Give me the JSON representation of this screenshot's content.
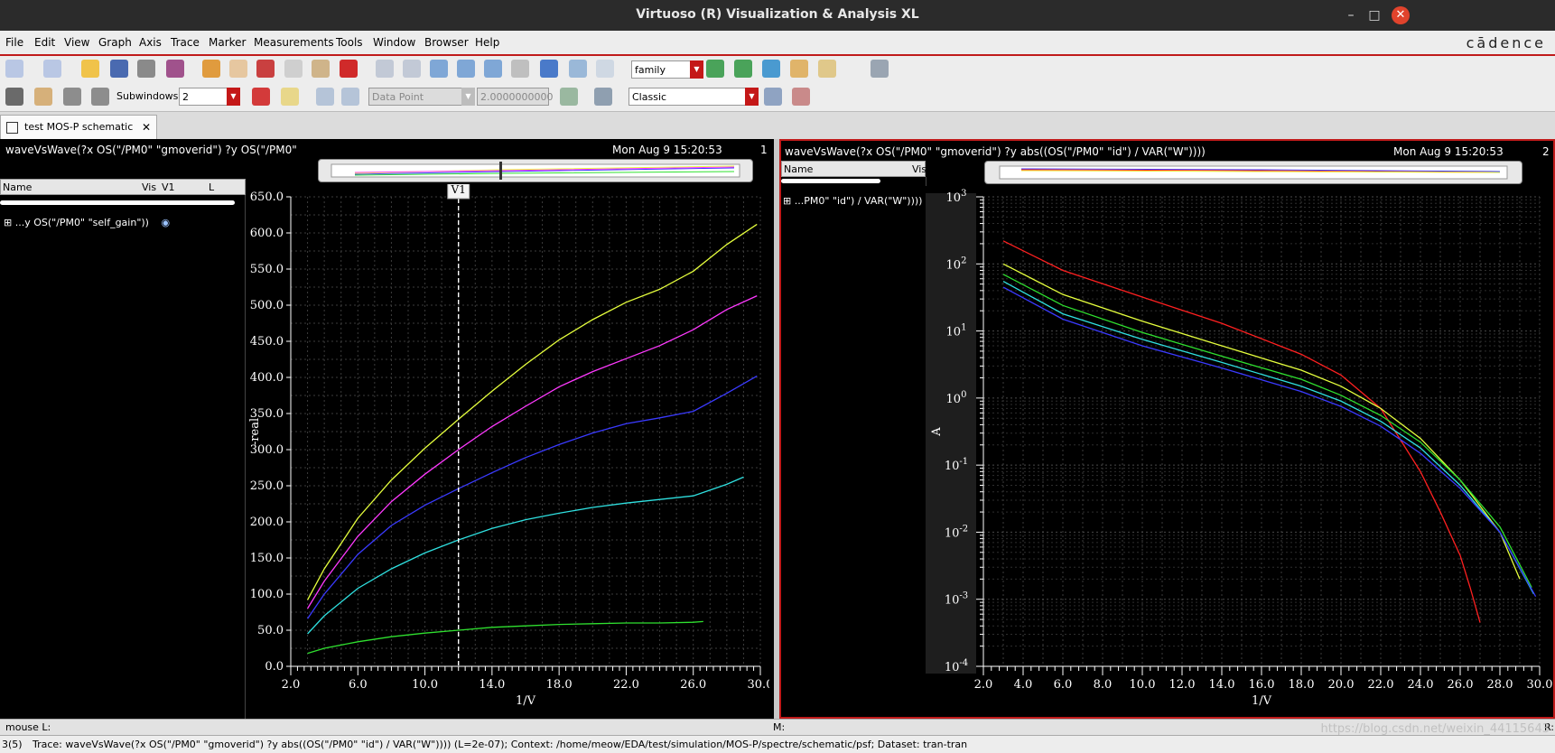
{
  "window": {
    "title": "Virtuoso (R) Visualization & Analysis XL",
    "brand": "cādence"
  },
  "menu": [
    "File",
    "Edit",
    "View",
    "Graph",
    "Axis",
    "Trace",
    "Marker",
    "Measurements",
    "Tools",
    "Window",
    "Browser",
    "Help"
  ],
  "toolbar": {
    "family_combo": "family",
    "subwindows_label": "Subwindows:",
    "subwindows_value": "2",
    "datapoint_combo": "Data Point",
    "datapoint_value": "2.0000000000",
    "classic_combo": "Classic"
  },
  "tab": {
    "label": "test MOS-P schematic"
  },
  "pane1": {
    "expr": "waveVsWave(?x OS(\"/PM0\" \"gmoverid\") ?y OS(\"/PM0\"",
    "date": "Mon Aug 9 15:20:53",
    "index": "1",
    "columns": [
      "Name",
      "Vis",
      "V1",
      "L"
    ],
    "trace_label": "...y OS(\"/PM0\" \"self_gain\"))",
    "marker_label": "V1"
  },
  "pane2": {
    "expr": "waveVsWave(?x OS(\"/PM0\" \"gmoverid\") ?y abs((OS(\"/PM0\" \"id\") / VAR(\"W\"))))",
    "date": "Mon Aug 9 15:20:53",
    "index": "2",
    "columns": [
      "Name",
      "Vis"
    ],
    "trace_label": "...PM0\" \"id\") / VAR(\"W\"))))"
  },
  "status": {
    "mouse": "mouse L:",
    "m": "M:",
    "r": "R:",
    "index": "3(5)",
    "trace": "Trace: waveVsWave(?x OS(\"/PM0\" \"gmoverid\") ?y abs((OS(\"/PM0\" \"id\") / VAR(\"W\")))) (L=2e-07); Context: /home/meow/EDA/test/simulation/MOS-P/spectre/schematic/psf; Dataset: tran-tran",
    "watermark": "https://blog.csdn.net/weixin_44115643"
  },
  "colors": {
    "yellow": "#e6ff3d",
    "magenta": "#ff39ff",
    "blue": "#3a3aff",
    "cyan": "#2fe0e0",
    "green": "#2fe02f",
    "red": "#ff2020",
    "grid": "#555555",
    "accent": "#c01a1a"
  },
  "chart_data": [
    {
      "type": "line",
      "xlabel": "1/V",
      "ylabel": "-real",
      "xlim": [
        2.0,
        30.0
      ],
      "ylim": [
        0.0,
        650.0
      ],
      "xticks": [
        "2.0",
        "6.0",
        "10.0",
        "14.0",
        "18.0",
        "22.0",
        "26.0",
        "30.0"
      ],
      "yticks": [
        "0.0",
        "50.0",
        "100.0",
        "150.0",
        "200.0",
        "250.0",
        "300.0",
        "350.0",
        "400.0",
        "450.0",
        "500.0",
        "550.0",
        "600.0",
        "650.0"
      ],
      "marker": {
        "label": "V1",
        "x": 12.0
      },
      "series": [
        {
          "color": "#e6ff3d",
          "x": [
            3,
            4,
            6,
            8,
            10,
            12,
            14,
            16,
            18,
            20,
            22,
            24,
            26,
            28,
            29.8
          ],
          "y": [
            92,
            135,
            205,
            258,
            302,
            342,
            381,
            418,
            452,
            480,
            504,
            522,
            547,
            584,
            612
          ]
        },
        {
          "color": "#ff39ff",
          "x": [
            3,
            4,
            6,
            8,
            10,
            12,
            14,
            16,
            18,
            20,
            22,
            24,
            26,
            28,
            29.8
          ],
          "y": [
            80,
            118,
            180,
            228,
            266,
            300,
            332,
            360,
            387,
            408,
            426,
            444,
            466,
            494,
            513
          ]
        },
        {
          "color": "#3a3aff",
          "x": [
            3,
            4,
            6,
            8,
            10,
            12,
            14,
            16,
            18,
            20,
            22,
            24,
            26,
            28,
            29.8
          ],
          "y": [
            66,
            100,
            155,
            195,
            223,
            246,
            268,
            289,
            307,
            323,
            336,
            344,
            353,
            378,
            402
          ]
        },
        {
          "color": "#2fe0e0",
          "x": [
            3,
            4,
            6,
            8,
            10,
            12,
            14,
            16,
            18,
            20,
            22,
            24,
            26,
            28,
            29
          ],
          "y": [
            45,
            70,
            108,
            135,
            157,
            175,
            191,
            203,
            212,
            220,
            226,
            231,
            236,
            252,
            262
          ]
        },
        {
          "color": "#2fe02f",
          "x": [
            3,
            4,
            6,
            8,
            10,
            12,
            14,
            16,
            18,
            20,
            22,
            24,
            26,
            26.6
          ],
          "y": [
            18,
            25,
            34,
            41,
            46,
            50,
            54,
            56,
            58,
            59,
            60,
            60,
            61,
            62
          ]
        }
      ]
    },
    {
      "type": "line",
      "xlabel": "1/V",
      "ylabel": "A",
      "yscale": "log",
      "xlim": [
        2.0,
        30.0
      ],
      "ylim": [
        0.0001,
        1000
      ],
      "xticks": [
        "2.0",
        "4.0",
        "6.0",
        "8.0",
        "10.0",
        "12.0",
        "14.0",
        "16.0",
        "18.0",
        "20.0",
        "22.0",
        "24.0",
        "26.0",
        "28.0",
        "30.0"
      ],
      "yticks": [
        "10^3",
        "10^2",
        "10^1",
        "10^0",
        "10^-1",
        "10^-2",
        "10^-3",
        "10^-4"
      ],
      "series": [
        {
          "color": "#ff2020",
          "x": [
            3,
            6,
            10,
            14,
            18,
            20,
            22,
            24,
            25,
            26,
            26.5,
            27
          ],
          "y": [
            220,
            80,
            32,
            13,
            4.5,
            2.2,
            0.7,
            0.08,
            0.02,
            0.0045,
            0.0015,
            0.00045
          ]
        },
        {
          "color": "#e6ff3d",
          "x": [
            3,
            6,
            10,
            14,
            18,
            20,
            22,
            24,
            26,
            28,
            29
          ],
          "y": [
            100,
            35,
            14,
            6,
            2.6,
            1.5,
            0.7,
            0.25,
            0.06,
            0.01,
            0.002
          ]
        },
        {
          "color": "#2fe02f",
          "x": [
            3,
            6,
            10,
            14,
            18,
            20,
            22,
            24,
            26,
            28,
            29.6
          ],
          "y": [
            70,
            24,
            9.5,
            4.2,
            1.9,
            1.1,
            0.55,
            0.22,
            0.06,
            0.012,
            0.0015
          ]
        },
        {
          "color": "#2fe0e0",
          "x": [
            3,
            6,
            10,
            14,
            18,
            20,
            22,
            24,
            26,
            28,
            29.7
          ],
          "y": [
            55,
            18,
            7.5,
            3.4,
            1.5,
            0.9,
            0.45,
            0.18,
            0.05,
            0.01,
            0.0012
          ]
        },
        {
          "color": "#3a3aff",
          "x": [
            3,
            6,
            10,
            14,
            18,
            20,
            22,
            24,
            26,
            28,
            29.8
          ],
          "y": [
            45,
            15,
            6,
            2.8,
            1.25,
            0.75,
            0.38,
            0.15,
            0.045,
            0.01,
            0.0011
          ]
        }
      ]
    }
  ]
}
